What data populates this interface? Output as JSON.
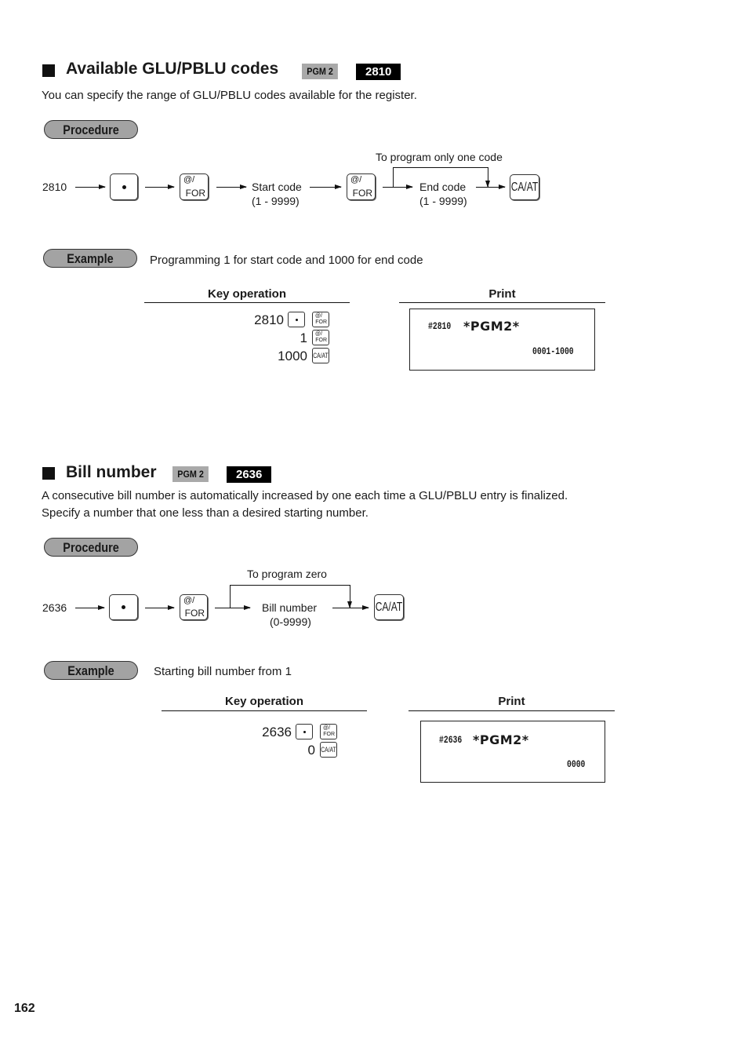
{
  "section1": {
    "title": "Available GLU/PBLU codes",
    "pgm_tag": "PGM 2",
    "code_tag": "2810",
    "description": "You can specify the range of GLU/PBLU codes available for the register.",
    "procedure_label": "Procedure",
    "flow": {
      "start_number": "2810",
      "dot_key": "dot-key",
      "for_key_top": "@/",
      "for_key_bottom": "FOR",
      "start_code_label": "Start code",
      "start_code_range": "(1 - 9999)",
      "bypass_label": "To program only one code",
      "end_code_label": "End code",
      "end_code_range": "(1 - 9999)",
      "ca_key": "CA/AT"
    },
    "example_label": "Example",
    "example_text": "Programming 1 for start code and 1000 for end code",
    "key_operation_header": "Key operation",
    "print_header": "Print",
    "key_operations": [
      {
        "number": "2810",
        "keys": [
          "dot",
          "for"
        ]
      },
      {
        "number": "1",
        "keys": [
          "for"
        ]
      },
      {
        "number": "1000",
        "keys": [
          "ca"
        ]
      }
    ],
    "print": {
      "line1_code": "#2810",
      "line1_mode": "*PGM2*",
      "line2_value": "0001-1000"
    }
  },
  "section2": {
    "title": "Bill number",
    "pgm_tag": "PGM 2",
    "code_tag": "2636",
    "description_line1": "A  consecutive bill number is automatically increased by one each time a GLU/PBLU entry is finalized.",
    "description_line2": "Specify a number that one less than a desired starting number.",
    "procedure_label": "Procedure",
    "flow": {
      "start_number": "2636",
      "for_key_top": "@/",
      "for_key_bottom": "FOR",
      "bypass_label": "To program zero",
      "bill_label": "Bill number",
      "bill_range": "(0-9999)",
      "ca_key": "CA/AT"
    },
    "example_label": "Example",
    "example_text": "Starting bill number from 1",
    "key_operation_header": "Key operation",
    "print_header": "Print",
    "key_operations": [
      {
        "number": "2636",
        "keys": [
          "dot",
          "for"
        ]
      },
      {
        "number": "0",
        "keys": [
          "ca"
        ]
      }
    ],
    "print": {
      "line1_code": "#2636",
      "line1_mode": "*PGM2*",
      "line2_value": "0000"
    }
  },
  "keys": {
    "for_top": "@/",
    "for_bottom": "FOR",
    "ca": "CA/AT"
  },
  "page_number": "162"
}
